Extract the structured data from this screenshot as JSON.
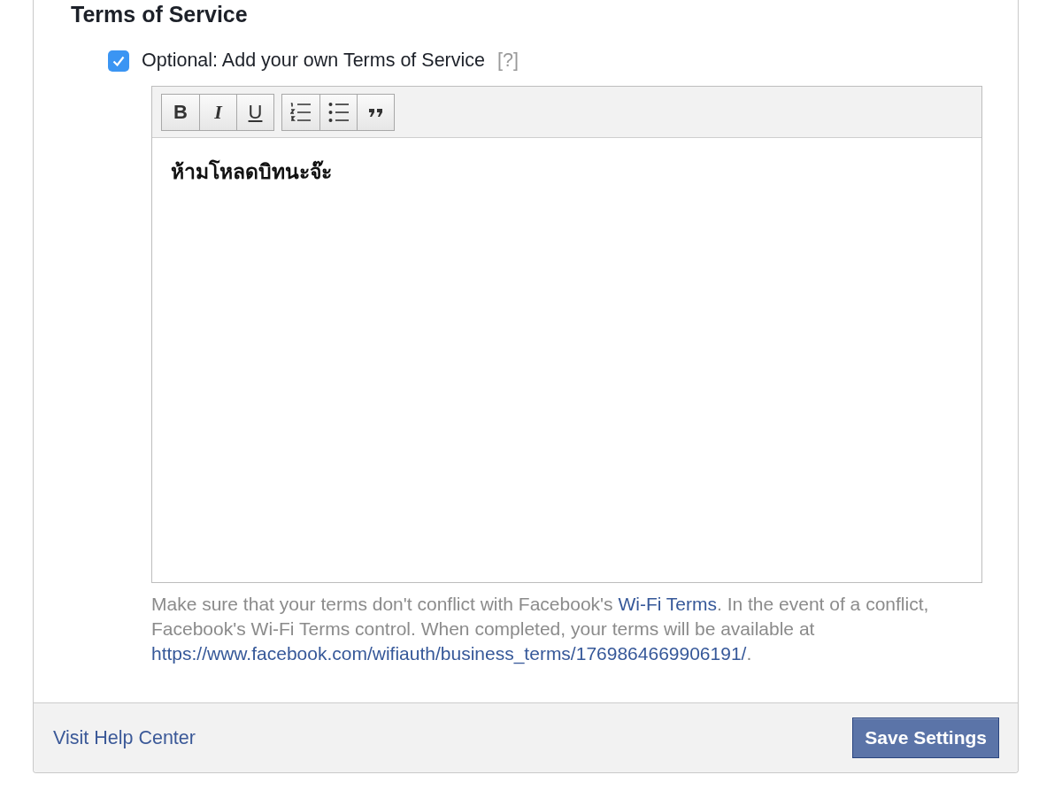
{
  "section": {
    "title": "Terms of Service"
  },
  "optional_terms": {
    "label": "Optional: Add your own Terms of Service",
    "help_marker": "[?]",
    "checked": true
  },
  "editor": {
    "toolbar_groups": [
      {
        "buttons": [
          {
            "kind": "bold",
            "label": "B"
          },
          {
            "kind": "italic",
            "label": "I"
          },
          {
            "kind": "underline",
            "label": "U"
          }
        ]
      },
      {
        "buttons": [
          {
            "kind": "numbered-list"
          },
          {
            "kind": "bulleted-list"
          },
          {
            "kind": "quote"
          }
        ]
      }
    ],
    "value": "ห้ามโหลดบิทนะจ๊ะ"
  },
  "help_text": [
    {
      "kind": "text",
      "text": "Make sure that your terms don't conflict with Facebook's "
    },
    {
      "kind": "link",
      "text": "Wi-Fi Terms"
    },
    {
      "kind": "text",
      "text": ". In the event of a conflict, Facebook's Wi-Fi Terms control. When completed, your terms will be available at "
    },
    {
      "kind": "link",
      "text": "https://www.facebook.com/wifiauth/business_terms/1769864669906191/"
    },
    {
      "kind": "text",
      "text": "."
    }
  ],
  "footer": {
    "help_link": "Visit Help Center",
    "save_button": "Save Settings"
  }
}
